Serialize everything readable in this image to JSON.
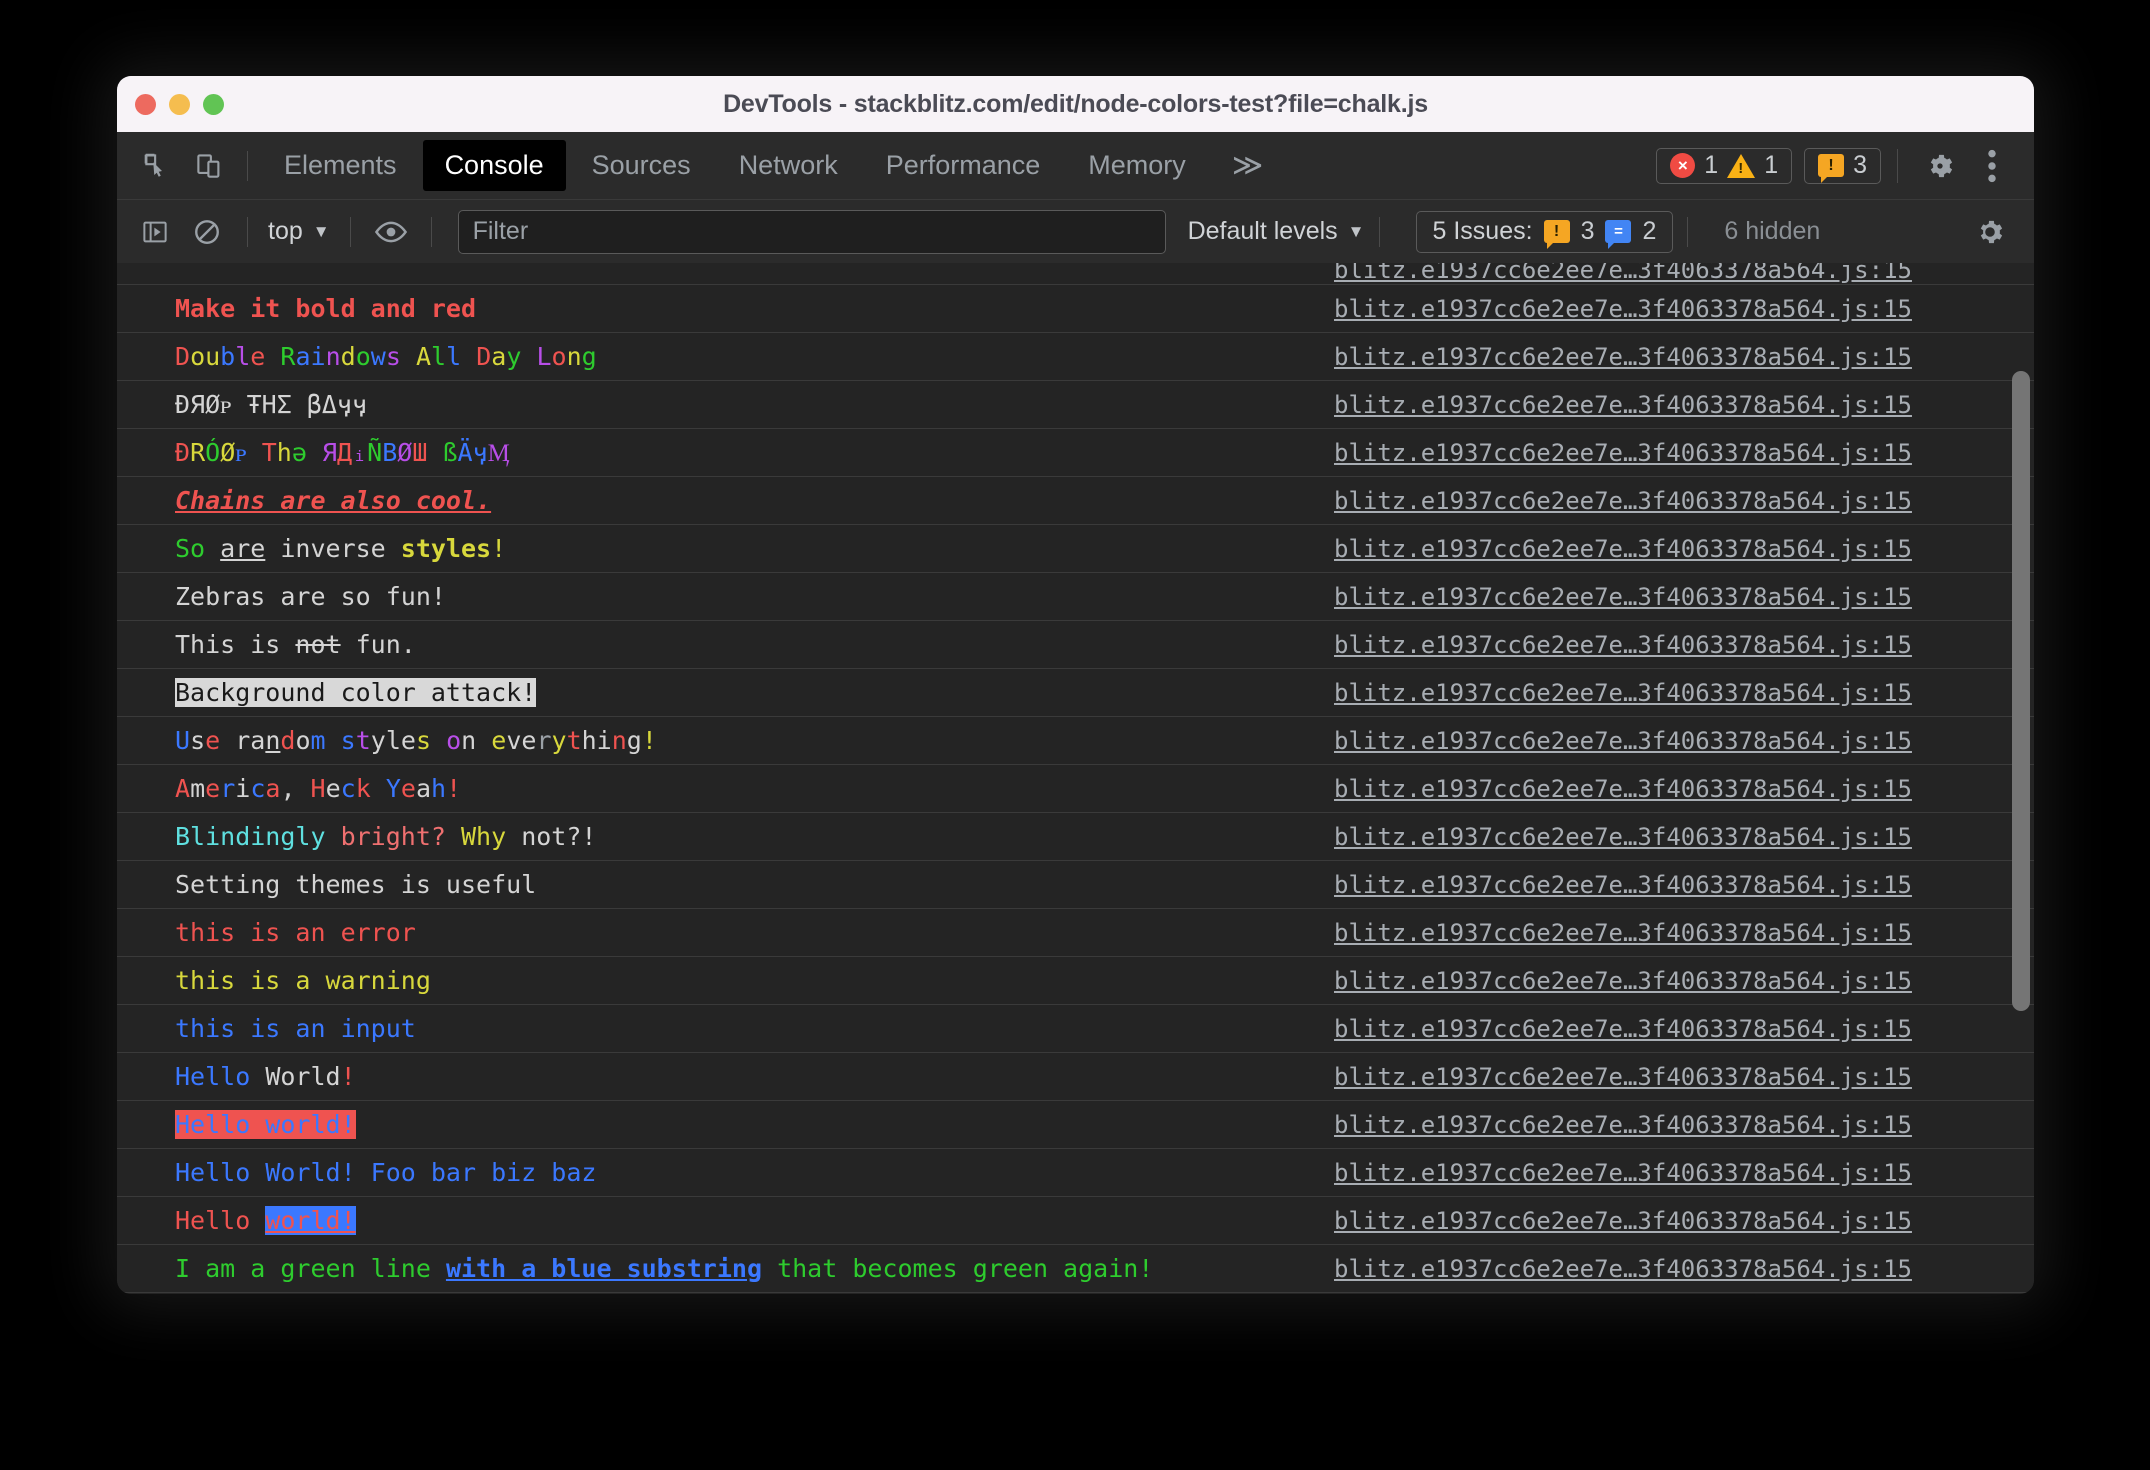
{
  "window": {
    "title": "DevTools - stackblitz.com/edit/node-colors-test?file=chalk.js",
    "traffic_lights": [
      "close",
      "minimize",
      "zoom"
    ]
  },
  "tabbar": {
    "tabs": [
      {
        "label": "Elements",
        "active": false
      },
      {
        "label": "Console",
        "active": true
      },
      {
        "label": "Sources",
        "active": false
      },
      {
        "label": "Network",
        "active": false
      },
      {
        "label": "Performance",
        "active": false
      },
      {
        "label": "Memory",
        "active": false
      }
    ],
    "more_label": "≫",
    "error_count": "1",
    "warning_count": "1",
    "issue_count": "3",
    "error_glyph": "×",
    "warning_glyph": "!",
    "issue_glyph": "!"
  },
  "console_toolbar": {
    "context_label": "top",
    "context_caret": "▼",
    "filter_placeholder": "Filter",
    "filter_value": "",
    "levels_label": "Default levels",
    "levels_caret": "▼",
    "issues_label": "5 Issues:",
    "issues_warn_count": "3",
    "issues_info_count": "2",
    "issues_warn_glyph": "!",
    "issues_info_glyph": "=",
    "hidden_label": "6 hidden"
  },
  "colors": {
    "chalk_red": "#ef5350",
    "chalk_green": "#2ecc2e",
    "chalk_blue": "#3b78ff",
    "chalk_yellow": "#d8d83c",
    "chalk_magenta": "#b84ee8",
    "chalk_cyan": "#5fe0e0",
    "chalk_white": "#d4d4d4",
    "chalk_gray": "#9aa0a6",
    "bg_white": "#d8d8d8",
    "bg_red": "#ef5350",
    "bg_blue": "#3b78ff",
    "error_red": "#f04b43",
    "warn_orange": "#f5a623",
    "info_blue": "#4285f4",
    "tab_active_bg": "#000000",
    "panel_bg": "#242424",
    "toolbar_bg": "#2b2b2b",
    "titlebar_bg": "#f7f3f7"
  },
  "source_link": "blitz.e1937cc6e2ee7e…3f4063378a564.js:15",
  "messages": [
    {
      "id": "partial-top",
      "partial": true,
      "segments": [
        {
          "text": "",
          "color": "#e2e23c"
        }
      ]
    },
    {
      "id": "bold-red",
      "segments": [
        {
          "text": "Make it bold and red",
          "color": "#ef5350",
          "bold": true
        }
      ]
    },
    {
      "id": "double-rainbow",
      "segments": [
        {
          "text": "D",
          "color": "#ef5350"
        },
        {
          "text": "ou",
          "color": "#d8d83c"
        },
        {
          "text": "b",
          "color": "#3b78ff"
        },
        {
          "text": "l",
          "color": "#b84ee8"
        },
        {
          "text": "e",
          "color": "#ef5350"
        },
        {
          "text": " ",
          "color": "#d4d4d4"
        },
        {
          "text": "R",
          "color": "#2ecc2e"
        },
        {
          "text": "ai",
          "color": "#3b78ff"
        },
        {
          "text": "n",
          "color": "#b84ee8"
        },
        {
          "text": "d",
          "color": "#d8d83c"
        },
        {
          "text": "o",
          "color": "#2ecc2e"
        },
        {
          "text": "w",
          "color": "#3b78ff"
        },
        {
          "text": "s",
          "color": "#b84ee8"
        },
        {
          "text": " ",
          "color": "#d4d4d4"
        },
        {
          "text": "A",
          "color": "#d8d83c"
        },
        {
          "text": "l",
          "color": "#2ecc2e"
        },
        {
          "text": "l",
          "color": "#3b78ff"
        },
        {
          "text": " ",
          "color": "#d4d4d4"
        },
        {
          "text": "D",
          "color": "#ef5350"
        },
        {
          "text": "a",
          "color": "#d8d83c"
        },
        {
          "text": "y",
          "color": "#2ecc2e"
        },
        {
          "text": " ",
          "color": "#d4d4d4"
        },
        {
          "text": "L",
          "color": "#b84ee8"
        },
        {
          "text": "o",
          "color": "#ef5350"
        },
        {
          "text": "n",
          "color": "#d8d83c"
        },
        {
          "text": "g",
          "color": "#2ecc2e"
        }
      ]
    },
    {
      "id": "drop-the-bass-plain",
      "segments": [
        {
          "text": "ÐЯØᴩ ŦΗΣ βΔӌӌ",
          "color": "#d4d4d4"
        }
      ]
    },
    {
      "id": "drop-the-rainbow-bass",
      "segments": [
        {
          "text": "Ð",
          "color": "#ef5350"
        },
        {
          "text": "R",
          "color": "#d8d83c"
        },
        {
          "text": "Ó",
          "color": "#2ecc2e"
        },
        {
          "text": "Ø",
          "color": "#d8d83c"
        },
        {
          "text": "ᴩ",
          "color": "#3b78ff"
        },
        {
          "text": " ",
          "color": "#d4d4d4"
        },
        {
          "text": "T",
          "color": "#ef5350"
        },
        {
          "text": "h",
          "color": "#d8d83c"
        },
        {
          "text": "ə",
          "color": "#2ecc2e"
        },
        {
          "text": " ",
          "color": "#d4d4d4"
        },
        {
          "text": "Я",
          "color": "#b84ee8"
        },
        {
          "text": "Д",
          "color": "#ef5350"
        },
        {
          "text": "ᵢ",
          "color": "#b84ee8"
        },
        {
          "text": "Ñ",
          "color": "#2ecc2e"
        },
        {
          "text": "B",
          "color": "#3b78ff"
        },
        {
          "text": "Ø",
          "color": "#b84ee8"
        },
        {
          "text": "Ш",
          "color": "#ef5350"
        },
        {
          "text": " ",
          "color": "#d4d4d4"
        },
        {
          "text": "ß",
          "color": "#2ecc2e"
        },
        {
          "text": "Ä",
          "color": "#3b78ff"
        },
        {
          "text": "ӌ",
          "color": "#3b78ff"
        },
        {
          "text": "Ӎ",
          "color": "#b84ee8"
        }
      ]
    },
    {
      "id": "chains-are-cool",
      "segments": [
        {
          "text": "Chains are also cool.",
          "color": "#ef5350",
          "bold": true,
          "italic": true,
          "underline": true
        }
      ]
    },
    {
      "id": "inverse-styles",
      "segments": [
        {
          "text": "So ",
          "color": "#2ecc2e"
        },
        {
          "text": "are",
          "color": "#d4d4d4",
          "underline": true
        },
        {
          "text": " inverse ",
          "color": "#d4d4d4"
        },
        {
          "text": "styles",
          "color": "#d8d83c",
          "bold": true
        },
        {
          "text": "!",
          "color": "#d8d83c"
        }
      ]
    },
    {
      "id": "zebras",
      "segments": [
        {
          "text": "Zebras are so fun!",
          "color": "#d4d4d4"
        }
      ]
    },
    {
      "id": "strikethrough",
      "segments": [
        {
          "text": "This is ",
          "color": "#d4d4d4"
        },
        {
          "text": "not",
          "color": "#d4d4d4",
          "strike": true
        },
        {
          "text": " fun.",
          "color": "#d4d4d4"
        }
      ]
    },
    {
      "id": "background-color-attack",
      "segments": [
        {
          "text": "Background color attack!",
          "color": "#1a1a1a",
          "bg": "#d8d8d8"
        }
      ]
    },
    {
      "id": "random-styles",
      "segments": [
        {
          "text": "U",
          "color": "#3b78ff"
        },
        {
          "text": "s",
          "color": "#d4d4d4"
        },
        {
          "text": "e",
          "color": "#ef5350"
        },
        {
          "text": " ",
          "color": "#d4d4d4"
        },
        {
          "text": "ra",
          "color": "#d4d4d4"
        },
        {
          "text": "n",
          "color": "#d4d4d4",
          "underline": true
        },
        {
          "text": "d",
          "color": "#ef5350"
        },
        {
          "text": "o",
          "color": "#d4d4d4"
        },
        {
          "text": "m",
          "color": "#3b78ff"
        },
        {
          "text": " ",
          "color": "#d4d4d4"
        },
        {
          "text": "s",
          "color": "#3b78ff"
        },
        {
          "text": "t",
          "color": "#b84ee8"
        },
        {
          "text": "yle",
          "color": "#d4d4d4"
        },
        {
          "text": "s",
          "color": "#d8d83c"
        },
        {
          "text": " ",
          "color": "#d4d4d4"
        },
        {
          "text": "o",
          "color": "#b84ee8"
        },
        {
          "text": "n",
          "color": "#d4d4d4"
        },
        {
          "text": " ",
          "color": "#d4d4d4"
        },
        {
          "text": "e",
          "color": "#d8d83c"
        },
        {
          "text": "ve",
          "color": "#d4d4d4"
        },
        {
          "text": "r",
          "color": "#9aa0a6"
        },
        {
          "text": "y",
          "color": "#d8d83c"
        },
        {
          "text": "t",
          "color": "#ef5350"
        },
        {
          "text": "hi",
          "color": "#d4d4d4"
        },
        {
          "text": "n",
          "color": "#ef5350"
        },
        {
          "text": "g",
          "color": "#d4d4d4"
        },
        {
          "text": "!",
          "color": "#d8d83c"
        }
      ]
    },
    {
      "id": "america-heck-yeah",
      "segments": [
        {
          "text": "A",
          "color": "#ef5350"
        },
        {
          "text": "m",
          "color": "#d4d4d4"
        },
        {
          "text": "e",
          "color": "#ef5350"
        },
        {
          "text": "r",
          "color": "#3b78ff"
        },
        {
          "text": "i",
          "color": "#d4d4d4"
        },
        {
          "text": "c",
          "color": "#3b78ff"
        },
        {
          "text": "a",
          "color": "#ef5350"
        },
        {
          "text": ", ",
          "color": "#d4d4d4"
        },
        {
          "text": "H",
          "color": "#ef5350"
        },
        {
          "text": "e",
          "color": "#d4d4d4"
        },
        {
          "text": "c",
          "color": "#3b78ff"
        },
        {
          "text": "k",
          "color": "#ef5350"
        },
        {
          "text": " ",
          "color": "#d4d4d4"
        },
        {
          "text": "Y",
          "color": "#3b78ff"
        },
        {
          "text": "e",
          "color": "#ef5350"
        },
        {
          "text": "a",
          "color": "#d4d4d4"
        },
        {
          "text": "h",
          "color": "#3b78ff"
        },
        {
          "text": "!",
          "color": "#ef5350"
        }
      ]
    },
    {
      "id": "blindingly-bright",
      "segments": [
        {
          "text": "Blindingly",
          "color": "#5fe0e0"
        },
        {
          "text": " ",
          "color": "#d4d4d4"
        },
        {
          "text": "bright?",
          "color": "#ef7070"
        },
        {
          "text": " ",
          "color": "#d4d4d4"
        },
        {
          "text": "Why",
          "color": "#d8d83c"
        },
        {
          "text": " not?!",
          "color": "#d4d4d4"
        }
      ]
    },
    {
      "id": "setting-themes",
      "segments": [
        {
          "text": "Setting themes is useful",
          "color": "#d4d4d4"
        }
      ]
    },
    {
      "id": "this-is-an-error",
      "segments": [
        {
          "text": "this is an error",
          "color": "#ef5350"
        }
      ]
    },
    {
      "id": "this-is-a-warning",
      "segments": [
        {
          "text": "this is a warning",
          "color": "#d8d83c"
        }
      ]
    },
    {
      "id": "this-is-an-input",
      "segments": [
        {
          "text": "this is an input",
          "color": "#3b78ff"
        }
      ]
    },
    {
      "id": "hello-world-blue-white",
      "segments": [
        {
          "text": "Hello",
          "color": "#3b78ff"
        },
        {
          "text": " ",
          "color": "#d4d4d4"
        },
        {
          "text": "World",
          "color": "#d4d4d4"
        },
        {
          "text": "!",
          "color": "#ef5350"
        }
      ]
    },
    {
      "id": "hello-world-on-red",
      "segments": [
        {
          "text": "Hello world!",
          "color": "#3b78ff",
          "bg": "#ef5350"
        }
      ]
    },
    {
      "id": "hello-world-foo-bar",
      "segments": [
        {
          "text": "Hello World! Foo bar biz baz",
          "color": "#3b78ff"
        }
      ]
    },
    {
      "id": "hello-world-on-blue",
      "segments": [
        {
          "text": "Hello ",
          "color": "#ef5350"
        },
        {
          "text": "world!",
          "color": "#ef5350",
          "bg": "#3b78ff",
          "underline": true
        }
      ]
    },
    {
      "id": "green-line-blue-substring",
      "segments": [
        {
          "text": "I am a green line ",
          "color": "#2ecc2e"
        },
        {
          "text": "with a blue substring",
          "color": "#3b78ff",
          "bold": true,
          "underline": true
        },
        {
          "text": " that becomes green again!",
          "color": "#2ecc2e"
        }
      ]
    },
    {
      "id": "last-clipped",
      "segments": [
        {
          "text": "",
          "color": "#d4d4d4"
        }
      ]
    }
  ]
}
